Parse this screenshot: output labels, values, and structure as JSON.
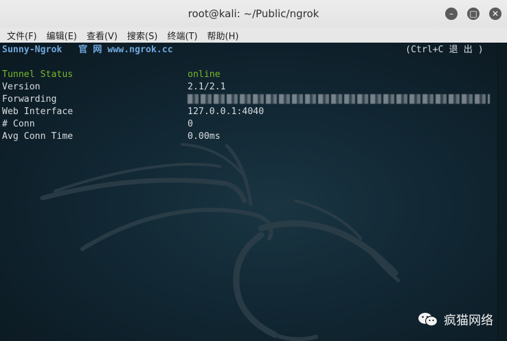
{
  "window": {
    "title": "root@kali: ~/Public/ngrok"
  },
  "menu": {
    "items": [
      {
        "label": "文件(F)"
      },
      {
        "label": "编辑(E)"
      },
      {
        "label": "查看(V)"
      },
      {
        "label": "搜索(S)"
      },
      {
        "label": "终端(T)"
      },
      {
        "label": "帮助(H)"
      }
    ]
  },
  "terminal": {
    "header_left": "Sunny-Ngrok   官 网 www.ngrok.cc",
    "header_right": "(Ctrl+C 退 出 )",
    "rows": [
      {
        "label": "Tunnel Status",
        "value": "online"
      },
      {
        "label": "Version",
        "value": "2.1/2.1"
      },
      {
        "label": "Forwarding",
        "value": ""
      },
      {
        "label": "Web Interface",
        "value": "127.0.0.1:4040"
      },
      {
        "label": "# Conn",
        "value": "0"
      },
      {
        "label": "Avg Conn Time",
        "value": "0.00ms"
      }
    ]
  },
  "watermark": {
    "text": "疯猫网络",
    "icon": "wechat-icon"
  },
  "colors": {
    "status_green": "#78b82a",
    "header_blue": "#6fa8dc",
    "text": "#d9dde1",
    "background": "#0f1c24"
  }
}
